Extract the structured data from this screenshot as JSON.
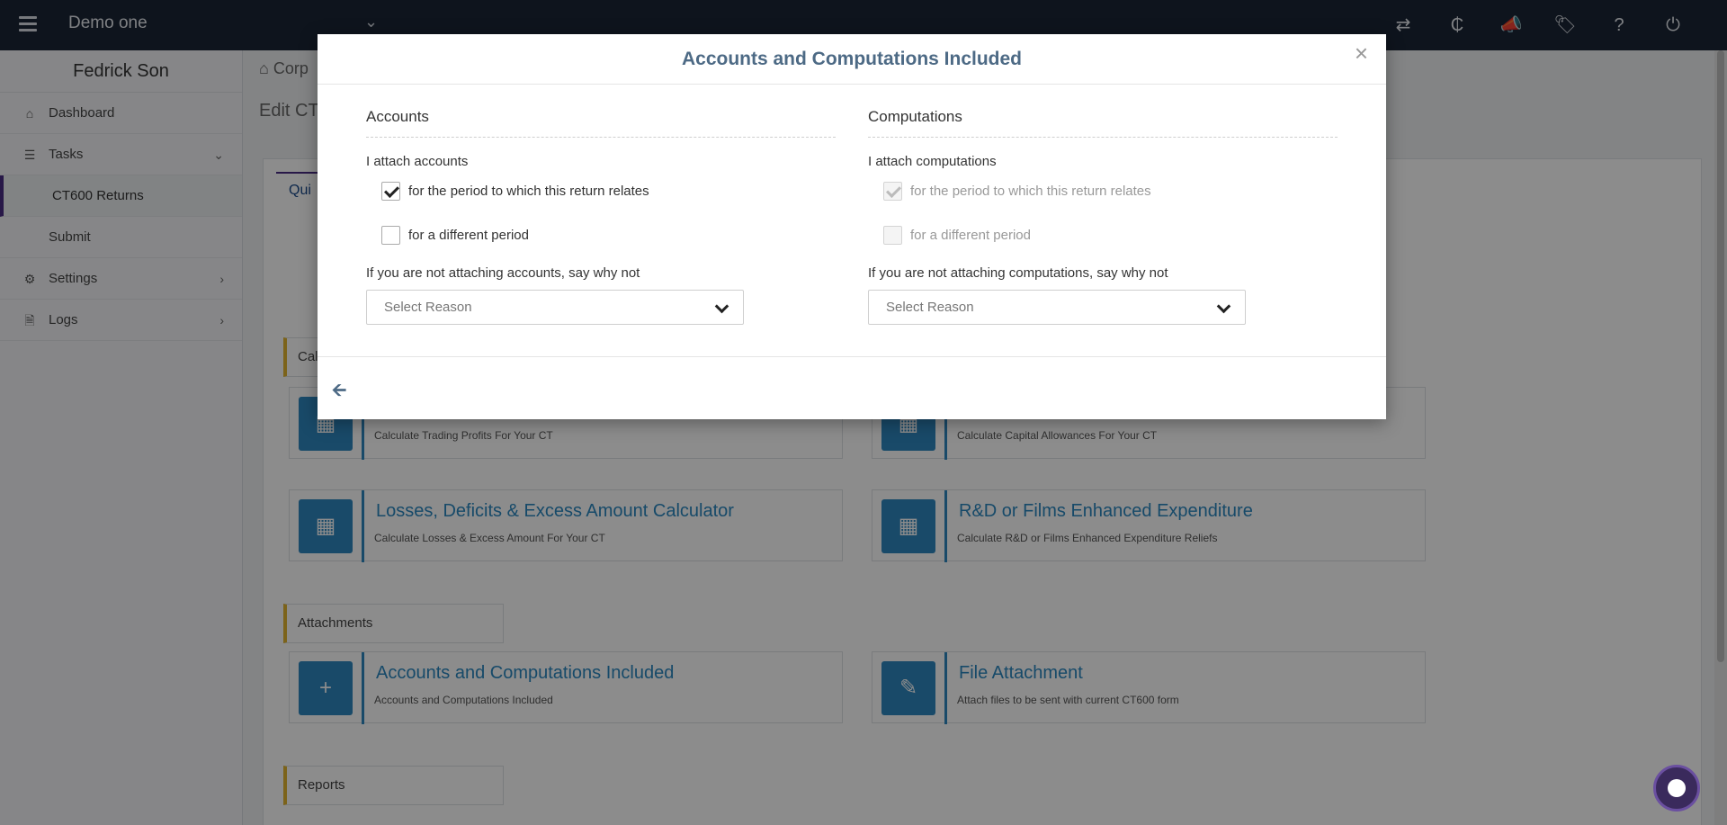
{
  "topbar": {
    "company": "Demo one",
    "icons": [
      "swap-icon",
      "currency-icon",
      "megaphone-icon",
      "tag-icon",
      "help-icon",
      "power-icon"
    ]
  },
  "sidebar": {
    "user": "Fedrick Son",
    "items": [
      {
        "label": "Dashboard",
        "icon": "home-icon"
      },
      {
        "label": "Tasks",
        "icon": "tasks-icon"
      },
      {
        "label": "Settings",
        "icon": "gear-icon"
      },
      {
        "label": "Logs",
        "icon": "file-icon"
      }
    ],
    "sub_items": [
      "CT600 Returns",
      "Submit"
    ]
  },
  "main": {
    "breadcrumb": "Corp",
    "edit_title": "Edit CT6",
    "quick_tab": "Qui",
    "sections": [
      "Cal",
      "Attachments",
      "Reports"
    ],
    "cards": [
      {
        "title": "",
        "subtitle": "Calculate Trading Profits For Your CT"
      },
      {
        "title": "",
        "subtitle": "Calculate Capital Allowances For Your CT"
      },
      {
        "title": "Losses, Deficits & Excess Amount Calculator",
        "subtitle": "Calculate Losses & Excess Amount For Your CT"
      },
      {
        "title": "R&D or Films Enhanced Expenditure",
        "subtitle": "Calculate R&D or Films Enhanced Expenditure Reliefs"
      },
      {
        "title": "Accounts and Computations Included",
        "subtitle": "Accounts and Computations Included"
      },
      {
        "title": "File Attachment",
        "subtitle": "Attach files to be sent with current CT600 form"
      }
    ]
  },
  "modal": {
    "title": "Accounts and Computations Included",
    "close": "×",
    "accounts": {
      "heading": "Accounts",
      "attach_label": "I attach accounts",
      "option_period": "for the period to which this return relates",
      "option_period_checked": true,
      "option_different": "for a different period",
      "option_different_checked": false,
      "why_label": "If you are not attaching accounts, say why not",
      "select_placeholder": "Select Reason"
    },
    "computations": {
      "heading": "Computations",
      "attach_label": "I attach computations",
      "option_period": "for the period to which this return relates",
      "option_period_checked": true,
      "option_different": "for a different period",
      "option_different_checked": false,
      "why_label": "If you are not attaching computations, say why not",
      "select_placeholder": "Select Reason"
    },
    "back": "🡨"
  }
}
